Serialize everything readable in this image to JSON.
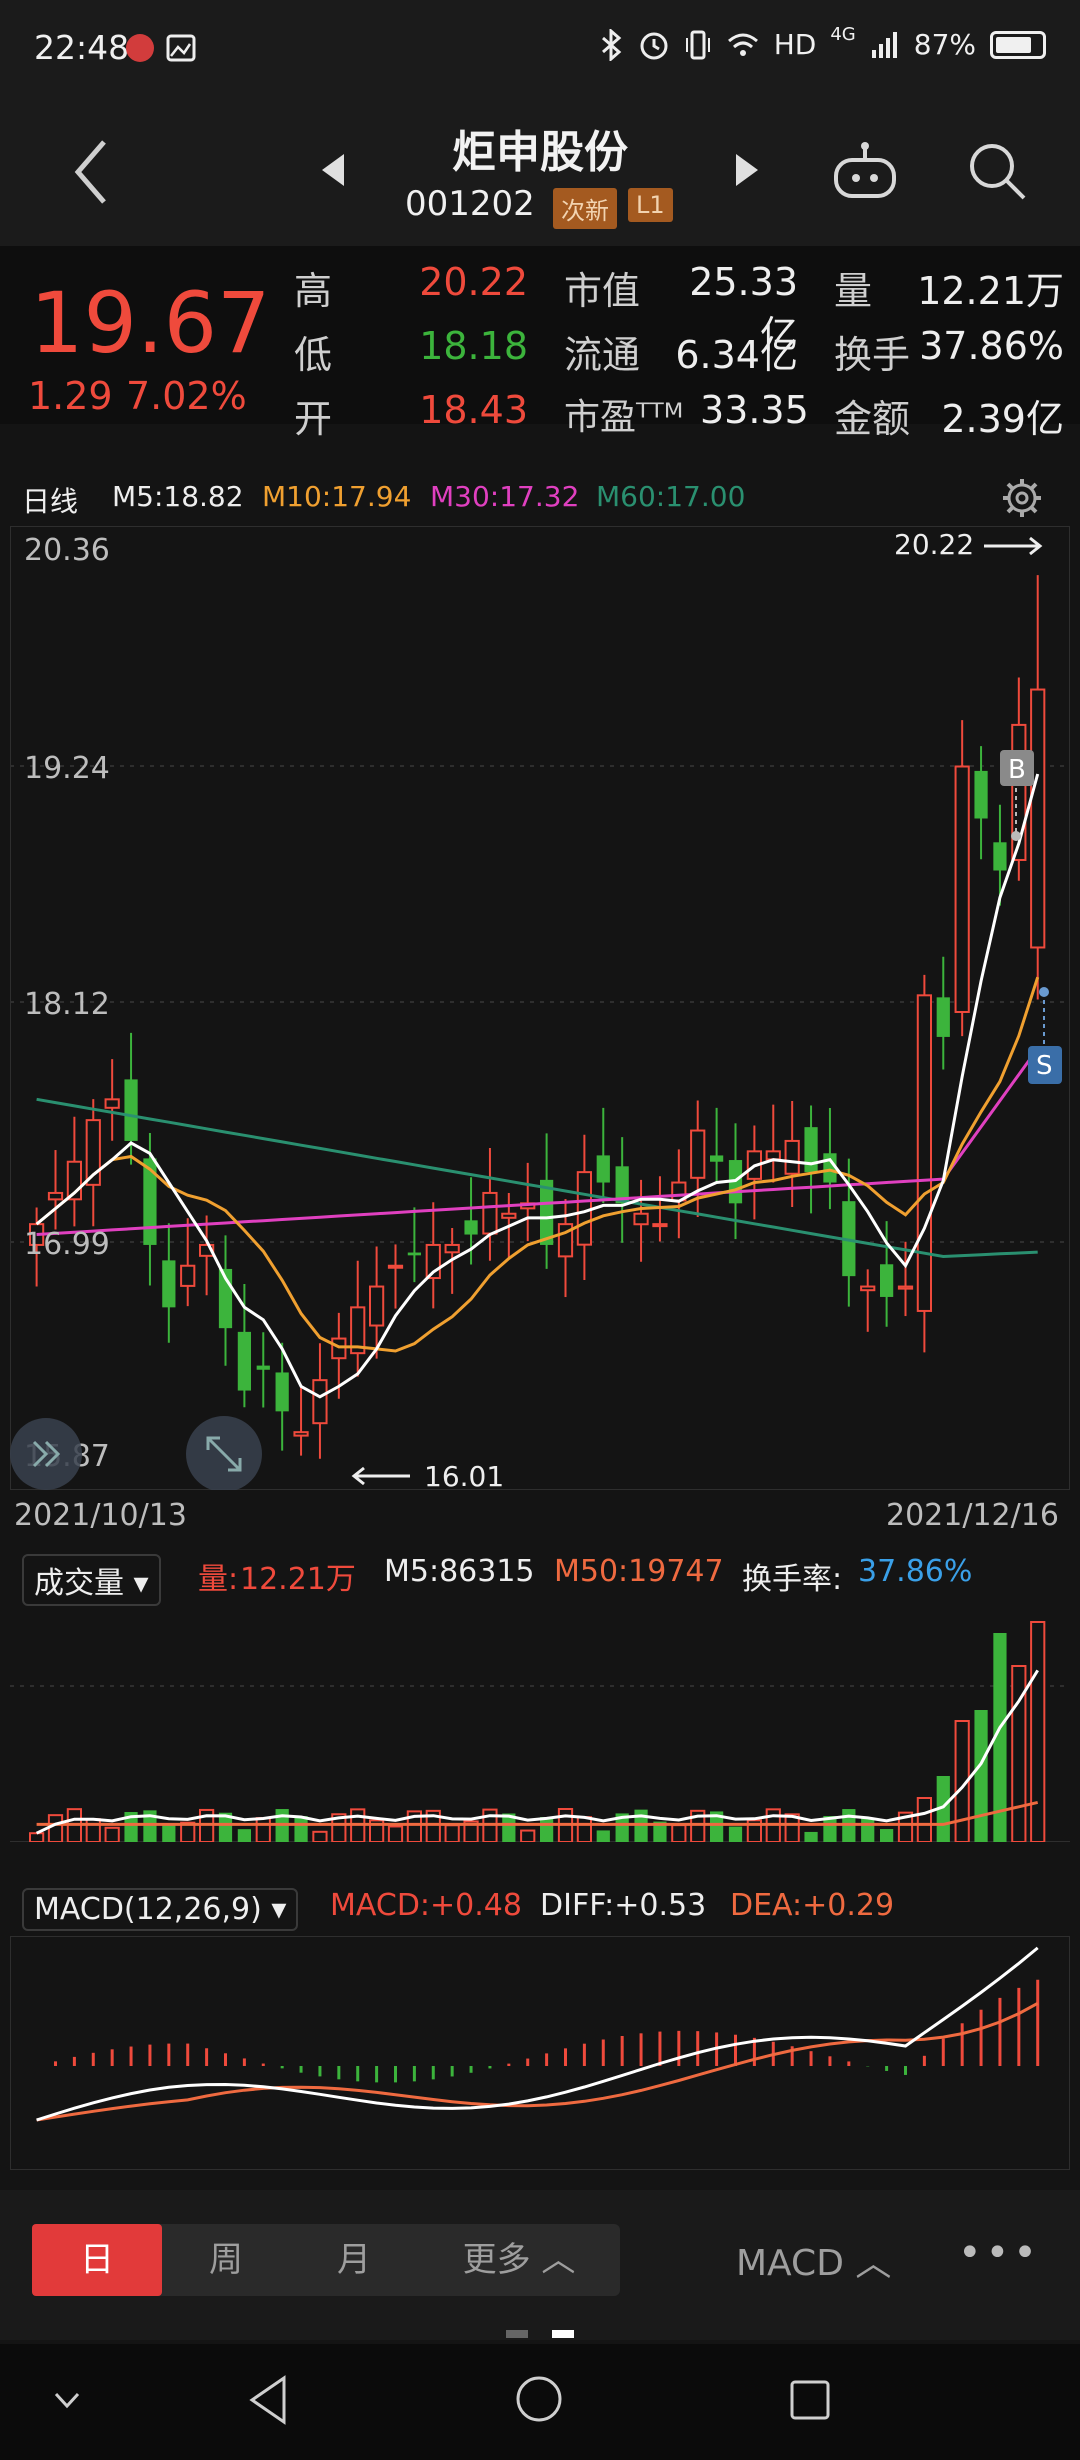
{
  "status_bar": {
    "time": "22:48",
    "network": "HD",
    "signal": "4G",
    "battery": "87%"
  },
  "header": {
    "stock_name": "炬申股份",
    "stock_code": "001202",
    "badge_new": "次新",
    "badge_level": "L1"
  },
  "quote": {
    "price": "19.67",
    "change": "1.29",
    "change_pct": "7.02%",
    "rows": [
      {
        "l1": "高",
        "v1": "20.22",
        "l2": "市值",
        "v2": "25.33亿",
        "l3": "量",
        "v3": "12.21万"
      },
      {
        "l1": "低",
        "v1": "18.18",
        "l2": "流通",
        "v2": "6.34亿",
        "l3": "换手",
        "v3": "37.86%"
      },
      {
        "l1": "开",
        "v1": "18.43",
        "l2": "市盈ᵀᵀᴹ",
        "v2": "33.35",
        "l3": "金额",
        "v3": "2.39亿"
      }
    ]
  },
  "kline_bar": {
    "period": "日线",
    "m5": "M5:18.82",
    "m10": "M10:17.94",
    "m30": "M30:17.32",
    "m60": "M60:17.00"
  },
  "kline": {
    "y_labels": [
      "20.36",
      "19.24",
      "18.12",
      "16.99",
      "15.87"
    ],
    "high_marker": "20.22",
    "low_marker": "16.01",
    "date_start": "2021/10/13",
    "date_end": "2021/12/16",
    "buy_marker": "B",
    "sell_marker": "S"
  },
  "volume_bar": {
    "selector": "成交量",
    "vol_label": "量:",
    "vol_value": "12.21万",
    "m5": "M5:86315",
    "m50": "M50:19747",
    "turnover_label": "换手率:",
    "turnover_value": "37.86%"
  },
  "macd_bar": {
    "selector": "MACD(12,26,9)",
    "macd": "MACD:+0.48",
    "diff": "DIFF:+0.53",
    "dea": "DEA:+0.29"
  },
  "tabs": {
    "day": "日",
    "week": "周",
    "month": "月",
    "more": "更多",
    "indicator": "MACD"
  },
  "chart_data": {
    "type": "candlestick",
    "x_start": "2021/10/13",
    "x_end": "2021/12/16",
    "ylim": [
      15.87,
      20.36
    ],
    "last_candle": {
      "open": 18.43,
      "high": 20.22,
      "low": 18.18,
      "close": 19.67
    },
    "period_low": 16.01,
    "ma": {
      "M5": 18.82,
      "M10": 17.94,
      "M30": 17.32,
      "M60": 17.0
    },
    "volume": {
      "last": "12.21万",
      "M5": 86315,
      "M50": 19747,
      "turnover": "37.86%"
    },
    "macd": {
      "MACD": 0.48,
      "DIFF": 0.53,
      "DEA": 0.29
    }
  },
  "colors": {
    "up": "#ef4a3c",
    "down": "#3cb43c",
    "m5": "#ffffff",
    "m10": "#f0a030",
    "m30": "#e040c0",
    "m60": "#2a9070",
    "accent": "#e23a3a",
    "turnover": "#3aa0e8"
  }
}
